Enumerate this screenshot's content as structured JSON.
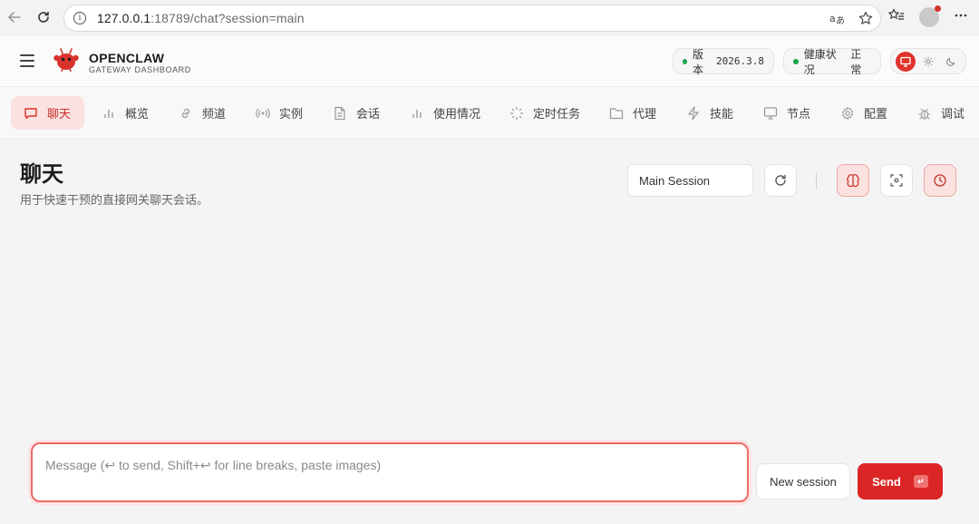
{
  "browser": {
    "url_host": "127.0.0.1",
    "url_path": ":18789/chat?session=main",
    "icons": [
      "back-arrow-icon",
      "reload-icon",
      "info-icon",
      "translate-icon",
      "star-icon",
      "favorites-icon",
      "profile-icon",
      "more-icon"
    ]
  },
  "header": {
    "brand": "OPENCLAW",
    "brand_sub": "GATEWAY DASHBOARD",
    "version_label": "版本",
    "version_value": "2026.3.8",
    "health_label": "健康状况",
    "health_value": "正常",
    "status_color": "#1aa34a",
    "accent_color": "#dc2626"
  },
  "tabs": [
    {
      "label": "聊天",
      "icon": "chat-icon",
      "active": true
    },
    {
      "label": "概览",
      "icon": "bar-chart-icon"
    },
    {
      "label": "频道",
      "icon": "link-icon"
    },
    {
      "label": "实例",
      "icon": "broadcast-icon"
    },
    {
      "label": "会话",
      "icon": "document-icon"
    },
    {
      "label": "使用情况",
      "icon": "bar-chart-icon"
    },
    {
      "label": "定时任务",
      "icon": "loader-icon"
    },
    {
      "label": "代理",
      "icon": "folder-icon"
    },
    {
      "label": "技能",
      "icon": "zap-icon"
    },
    {
      "label": "节点",
      "icon": "monitor-icon"
    },
    {
      "label": "配置",
      "icon": "gear-icon"
    },
    {
      "label": "调试",
      "icon": "bug-icon"
    }
  ],
  "main": {
    "title": "聊天",
    "subtitle": "用于快速干预的直接网关聊天会话。",
    "session_value": "Main Session",
    "composer_placeholder": "Message (↩ to send, Shift+↩ for line breaks, paste images)",
    "new_session_label": "New session",
    "send_label": "Send",
    "send_key": "↵"
  }
}
